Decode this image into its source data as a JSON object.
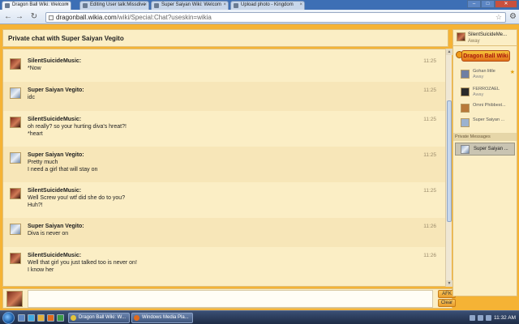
{
  "browser": {
    "tabs": [
      {
        "title": "Dragon Ball Wiki: Welcom",
        "active": true
      },
      {
        "title": "Editing User talk:Missdive",
        "active": false
      },
      {
        "title": "Super Saiyan Wiki: Welcom",
        "active": false
      },
      {
        "title": "Upload photo - Kingdom",
        "active": false
      }
    ],
    "url_domain": "dragonball.wikia.com",
    "url_path": "/wiki/Special:Chat?useskin=wikia",
    "close_glyph": "×",
    "window_controls": [
      "–",
      "□",
      "✕"
    ]
  },
  "chat": {
    "header_title": "Private chat with Super Saiyan Vegito",
    "messages": [
      {
        "user": "SilentSuicideMusic:",
        "lines": [
          "*Now"
        ],
        "time": "11:25",
        "avatar": "ssm"
      },
      {
        "user": "Super Saiyan Vegito:",
        "lines": [
          "idc"
        ],
        "time": "11:25",
        "avatar": "ssv"
      },
      {
        "user": "SilentSuicideMusic:",
        "lines": [
          "oh really? so your hurting diva's hreat?!",
          "*heart"
        ],
        "time": "11:25",
        "avatar": "ssm"
      },
      {
        "user": "Super Saiyan Vegito:",
        "lines": [
          "Pretty much",
          "I need a girl that will stay on"
        ],
        "time": "11:25",
        "avatar": "ssv"
      },
      {
        "user": "SilentSuicideMusic:",
        "lines": [
          "Well Screw you! wtf did she do to you?",
          "Huh?!"
        ],
        "time": "11:25",
        "avatar": "ssm"
      },
      {
        "user": "Super Saiyan Vegito:",
        "lines": [
          "Diva is never on"
        ],
        "time": "11:26",
        "avatar": "ssv"
      },
      {
        "user": "SilentSuicideMusic:",
        "lines": [
          "Well that girl you just talked too is never on!",
          "I know her"
        ],
        "time": "11:26",
        "avatar": "ssm"
      }
    ],
    "input_placeholder": "",
    "afk_label": "AFK",
    "clear_label": "Clear"
  },
  "rail": {
    "me": {
      "name": "SilentSuicideMe...",
      "status": "Away"
    },
    "logo_text": "Dragon Ball Wiki",
    "users": [
      {
        "name": "Gohan little",
        "status": "Away",
        "starred": true,
        "color": "#6f7fa3"
      },
      {
        "name": "FERROZAEL",
        "status": "Away",
        "starred": false,
        "color": "#2b2b2b"
      },
      {
        "name": "Omni Phibbest...",
        "status": "",
        "starred": false,
        "color": "#b8793a"
      },
      {
        "name": "Super Saiyan ...",
        "status": "",
        "starred": false,
        "color": "#9bb2cf"
      }
    ],
    "favorite_glyph": "★",
    "pm_header": "Private Messages",
    "pm_user": "Super Saiyan ..."
  },
  "taskbar": {
    "tasks": [
      "Dragon Ball Wiki: W...",
      "Windows Media Pla..."
    ],
    "clock": "11:32 AM"
  }
}
